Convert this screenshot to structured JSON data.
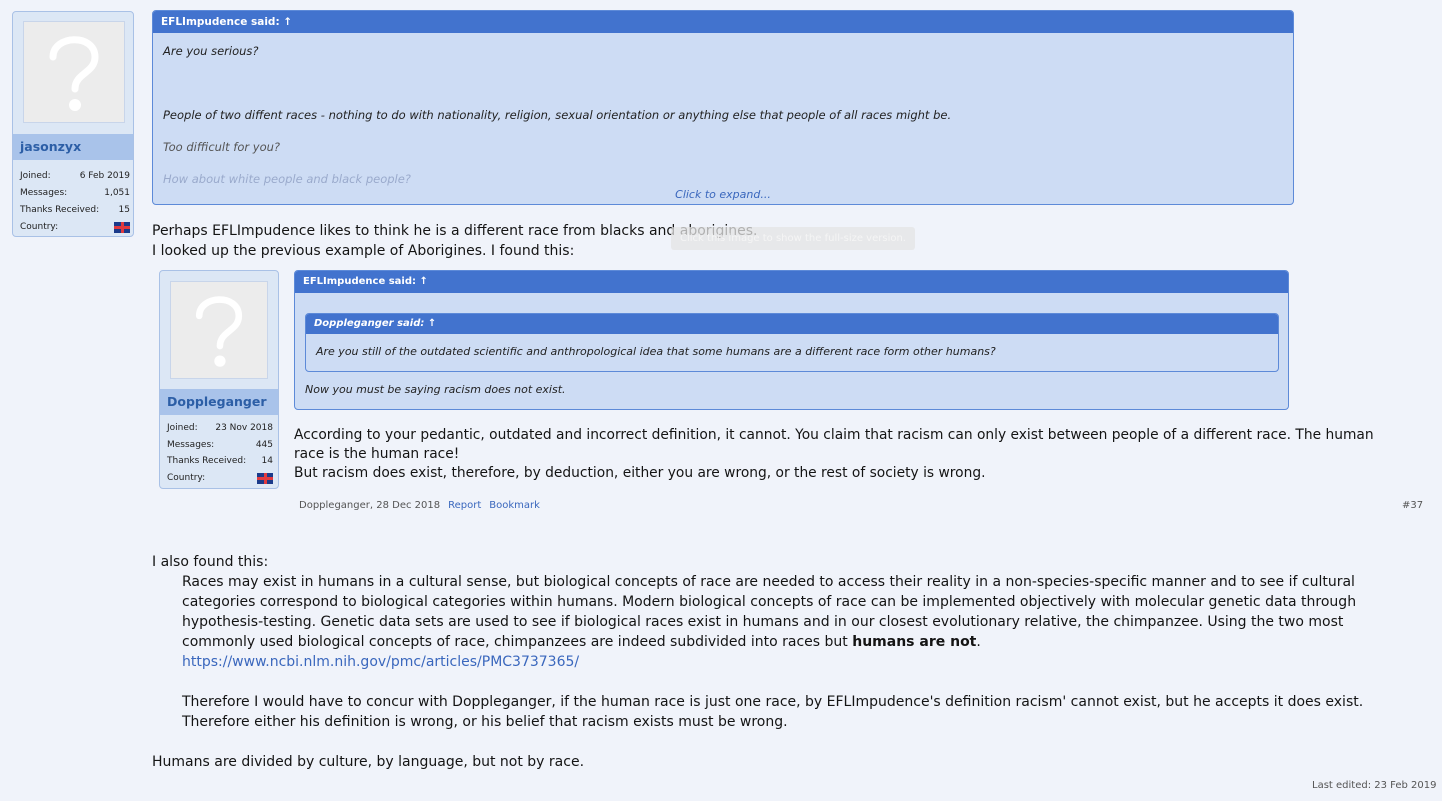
{
  "post_author": {
    "name": "jasonzyx",
    "joined_label": "Joined:",
    "joined": "6 Feb 2019",
    "messages_label": "Messages:",
    "messages": "1,051",
    "thanks_label": "Thanks Received:",
    "thanks": "15",
    "country_label": "Country:"
  },
  "quote1": {
    "header": "EFLImpudence said: ↑",
    "lines": [
      "Are you serious?",
      "People of two diffent races - nothing to do with nationality, religion, sexual orientation or anything else that people of all races might be.",
      "Too difficult for you?",
      "How about white people and black people?"
    ],
    "expand": "Click to expand..."
  },
  "intro_lines": [
    "Perhaps EFLImpudence likes to think he is a different race from blacks and aborigines.",
    "I looked up the previous example of Aborigines. I found this:"
  ],
  "tooltip": "Click this image to show the full-size version.",
  "embedded_post": {
    "user": {
      "name": "Doppleganger",
      "joined_label": "Joined:",
      "joined": "23 Nov 2018",
      "messages_label": "Messages:",
      "messages": "445",
      "thanks_label": "Thanks Received:",
      "thanks": "14",
      "country_label": "Country:"
    },
    "quote": {
      "header": "EFLImpudence said: ↑",
      "inner_header": "Doppleganger said: ↑",
      "inner_text": "Are you still of the outdated scientific and anthropological idea that some humans are a different race form other humans?",
      "text": "Now you must be saying racism does not exist."
    },
    "body": [
      "According to your pedantic, outdated and incorrect definition, it cannot. You claim that racism can only exist between people of a different race. The human",
      "race is the human race!",
      "But racism does exist, therefore, by deduction, either you are wrong, or the rest of society is wrong."
    ],
    "meta": "Doppleganger, 28 Dec 2018",
    "report": "Report",
    "bookmark": "Bookmark",
    "post_number": "#37"
  },
  "also_found": "I also found this:",
  "citation": [
    "Races may exist in humans in a cultural sense, but biological concepts of race are needed to access their reality in a non-species-specific manner and to see if cultural",
    "categories correspond to biological categories within humans. Modern biological concepts of race can be implemented objectively with molecular genetic data through",
    "hypothesis-testing. Genetic data sets are used to see if biological races exist in humans and in our closest evolutionary relative, the chimpanzee. Using the two most"
  ],
  "citation_last_pre": "commonly used biological concepts of race, chimpanzees are indeed subdivided into races but ",
  "citation_bold": "humans are not",
  "citation_last_post": ".",
  "url": "https://www.ncbi.nlm.nih.gov/pmc/articles/PMC3737365/",
  "conclusion": [
    "Therefore I would have to concur with Doppleganger, if the human race is just one race, by EFLImpudence's definition racism' cannot exist, but he accepts it does exist.",
    "Therefore either his definition is wrong, or his belief that racism exists must be wrong."
  ],
  "closing": "Humans are divided by culture, by language, but not by race.",
  "last_edited": "Last edited: 23 Feb 2019",
  "icons": {
    "avatar": "default-avatar-icon",
    "flag": "uk-flag-icon"
  },
  "colors": {
    "quote_header": "#4273ce",
    "quote_bg": "#cddcf4",
    "link": "#3a67bd",
    "page_bg": "#f0f3fa"
  }
}
